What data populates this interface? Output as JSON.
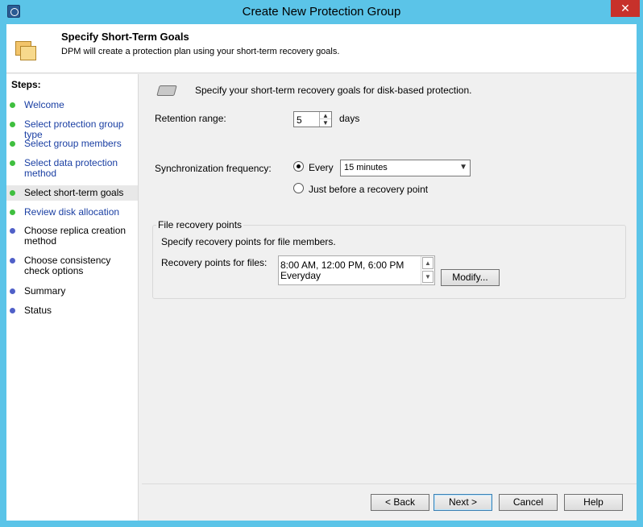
{
  "window": {
    "title": "Create New Protection Group",
    "close_glyph": "✕"
  },
  "header": {
    "title": "Specify Short-Term Goals",
    "subtitle": "DPM will create a protection plan using your short-term recovery goals."
  },
  "steps": {
    "title": "Steps:",
    "items": [
      {
        "label": "Welcome",
        "state": "done"
      },
      {
        "label": "Select protection group type",
        "state": "done"
      },
      {
        "label": "Select group members",
        "state": "done"
      },
      {
        "label": "Select data protection method",
        "state": "done"
      },
      {
        "label": "Select short-term goals",
        "state": "current"
      },
      {
        "label": "Review disk allocation",
        "state": "done"
      },
      {
        "label": "Choose replica creation method",
        "state": "todo"
      },
      {
        "label": "Choose consistency check options",
        "state": "todo"
      },
      {
        "label": "Summary",
        "state": "todo"
      },
      {
        "label": "Status",
        "state": "todo"
      }
    ]
  },
  "main": {
    "intro": "Specify your short-term recovery goals for disk-based protection.",
    "retention_label": "Retention range:",
    "retention_value": "5",
    "retention_unit": "days",
    "sync_label": "Synchronization frequency:",
    "every_label": "Every",
    "every_selected": true,
    "frequency_value": "15 minutes",
    "before_recovery_label": "Just before a recovery point",
    "before_recovery_selected": false,
    "file_group_title": "File recovery points",
    "file_group_desc": "Specify recovery points for file members.",
    "recovery_points_label": "Recovery points for files:",
    "recovery_points_line1": "8:00 AM, 12:00 PM, 6:00 PM",
    "recovery_points_line2": "Everyday",
    "modify_label": "Modify..."
  },
  "footer": {
    "back_label": "< Back",
    "next_label": "Next >",
    "cancel_label": "Cancel",
    "help_label": "Help"
  }
}
